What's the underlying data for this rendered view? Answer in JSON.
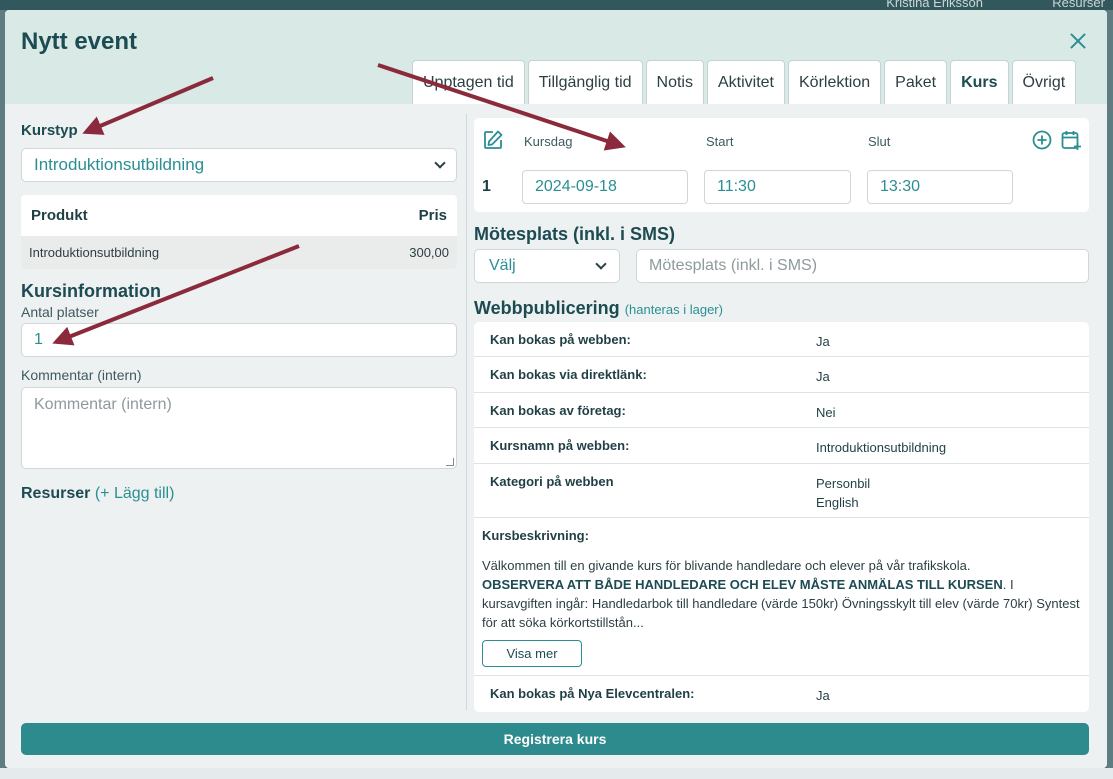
{
  "background": {
    "user_name": "Kristina Eriksson",
    "resources_label": "Resurser"
  },
  "modal": {
    "title": "Nytt event",
    "tabs": [
      {
        "label": "Upptagen tid",
        "active": false
      },
      {
        "label": "Tillgänglig tid",
        "active": false
      },
      {
        "label": "Notis",
        "active": false
      },
      {
        "label": "Aktivitet",
        "active": false
      },
      {
        "label": "Körlektion",
        "active": false
      },
      {
        "label": "Paket",
        "active": false
      },
      {
        "label": "Kurs",
        "active": true
      },
      {
        "label": "Övrigt",
        "active": false
      }
    ]
  },
  "left": {
    "course_type_label": "Kurstyp",
    "course_type_value": "Introduktionsutbildning",
    "product_table": {
      "headers": [
        "Produkt",
        "Pris"
      ],
      "rows": [
        {
          "product": "Introduktionsutbildning",
          "price": "300,00"
        }
      ]
    },
    "course_info_title": "Kursinformation",
    "seats_label": "Antal platser",
    "seats_value": "1",
    "comment_label": "Kommentar (intern)",
    "comment_placeholder": "Kommentar (intern)",
    "resources_label": "Resurser",
    "resources_add": "(+ Lägg till)"
  },
  "session": {
    "col_day": "Kursdag",
    "col_start": "Start",
    "col_end": "Slut",
    "row": {
      "number": "1",
      "date": "2024-09-18",
      "start": "11:30",
      "end": "13:30"
    }
  },
  "meeting": {
    "title": "Mötesplats (inkl. i SMS)",
    "select_value": "Välj",
    "input_placeholder": "Mötesplats (inkl. i SMS)"
  },
  "web": {
    "title": "Webbpublicering",
    "note": "(hanteras i lager)",
    "rows": [
      {
        "key": "Kan bokas på webben:",
        "value": "Ja"
      },
      {
        "key": "Kan bokas via direktlänk:",
        "value": "Ja"
      },
      {
        "key": "Kan bokas av företag:",
        "value": "Nei"
      },
      {
        "key": "Kursnamn på webben:",
        "value": "Introduktionsutbildning"
      },
      {
        "key": "Kategori på webben",
        "value_line1": "Personbil",
        "value_line2": "English"
      }
    ],
    "description_label": "Kursbeskrivning:",
    "description_intro": "Välkommen till en givande kurs för blivande handledare och elever på vår trafikskola.",
    "description_bold": "OBSERVERA ATT BÅDE HANDLEDARE OCH ELEV MÅSTE ANMÄLAS TILL KURSEN",
    "description_rest": ". I kursavgiften ingår: Handledarbok till handledare (värde 150kr) Övningsskylt till elev (värde 70kr) Syntest för att söka körkortstillstån...",
    "show_more": "Visa mer",
    "last_row": {
      "key": "Kan bokas på Nya Elevcentralen:",
      "value": "Ja"
    }
  },
  "submit_label": "Registrera kurs",
  "colors": {
    "accent": "#2d8a8d",
    "header_bg": "#d8e9e6",
    "arrow": "#8b2a3c",
    "title": "#1d4b52"
  }
}
